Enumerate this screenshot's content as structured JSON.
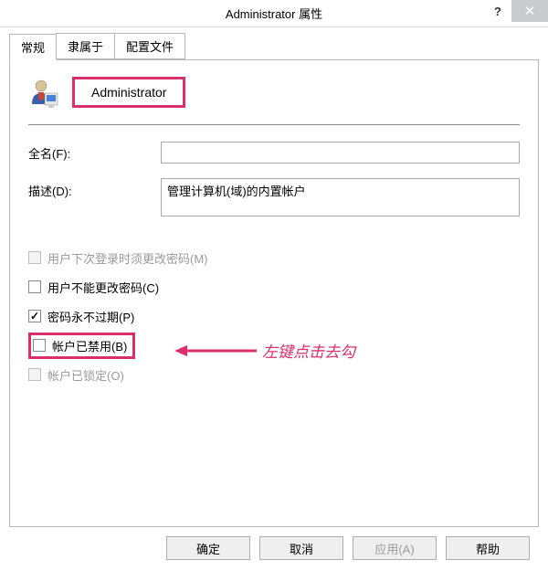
{
  "titlebar": {
    "title": "Administrator 属性",
    "help": "?",
    "close": "✕"
  },
  "tabs": {
    "general": "常规",
    "memberof": "隶属于",
    "profile": "配置文件"
  },
  "user": {
    "name": "Administrator"
  },
  "fields": {
    "fullname_label": "全名(F):",
    "fullname_value": "",
    "description_label": "描述(D):",
    "description_value": "管理计算机(域)的内置帐户"
  },
  "checkboxes": {
    "must_change": "用户下次登录时须更改密码(M)",
    "cannot_change": "用户不能更改密码(C)",
    "never_expire": "密码永不过期(P)",
    "disabled": "帐户已禁用(B)",
    "locked": "帐户已锁定(O)"
  },
  "annotation": {
    "text": "左键点击去勾"
  },
  "buttons": {
    "ok": "确定",
    "cancel": "取消",
    "apply": "应用(A)",
    "help": "帮助"
  }
}
